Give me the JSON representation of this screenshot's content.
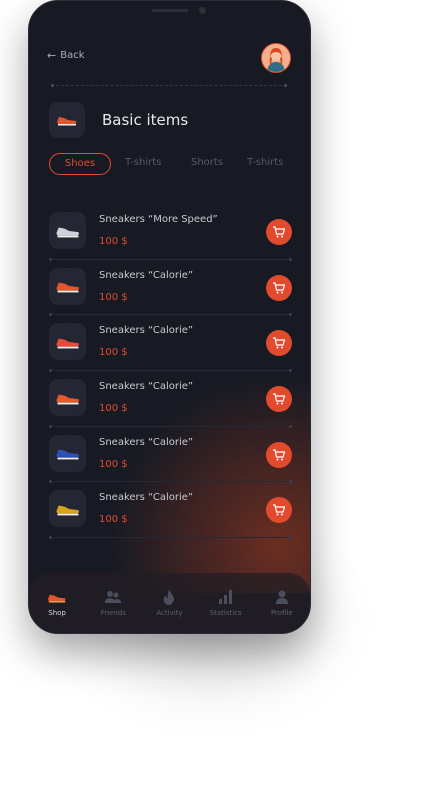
{
  "header": {
    "back_label": "Back"
  },
  "category": {
    "title": "Basic items",
    "icon": "sneaker-icon"
  },
  "tabs": [
    {
      "label": "Shoes",
      "active": true
    },
    {
      "label": "T-shirts",
      "active": false
    },
    {
      "label": "Shorts",
      "active": false
    },
    {
      "label": "T-shirts",
      "active": false
    }
  ],
  "products": [
    {
      "name": "Sneakers “More Speed”",
      "price": "100 $",
      "shoe_color": "#cfd2d8"
    },
    {
      "name": "Sneakers “Calorie”",
      "price": "100 $",
      "shoe_color": "#e2562d"
    },
    {
      "name": "Sneakers “Calorie”",
      "price": "100 $",
      "shoe_color": "#e84a3a"
    },
    {
      "name": "Sneakers “Calorie”",
      "price": "100 $",
      "shoe_color": "#e45a2b"
    },
    {
      "name": "Sneakers “Calorie”",
      "price": "100 $",
      "shoe_color": "#2f4fb8"
    },
    {
      "name": "Sneakers “Calorie”",
      "price": "100 $",
      "shoe_color": "#d8a31c"
    }
  ],
  "nav": [
    {
      "label": "Shop",
      "icon": "shoe-icon",
      "active": true
    },
    {
      "label": "Friends",
      "icon": "friends-icon",
      "active": false
    },
    {
      "label": "Activity",
      "icon": "flame-icon",
      "active": false
    },
    {
      "label": "Statistics",
      "icon": "bar-chart-icon",
      "active": false
    },
    {
      "label": "Profile",
      "icon": "profile-icon",
      "active": false
    }
  ],
  "colors": {
    "accent": "#e24a2e",
    "background": "#181a23",
    "surface": "#242733"
  }
}
